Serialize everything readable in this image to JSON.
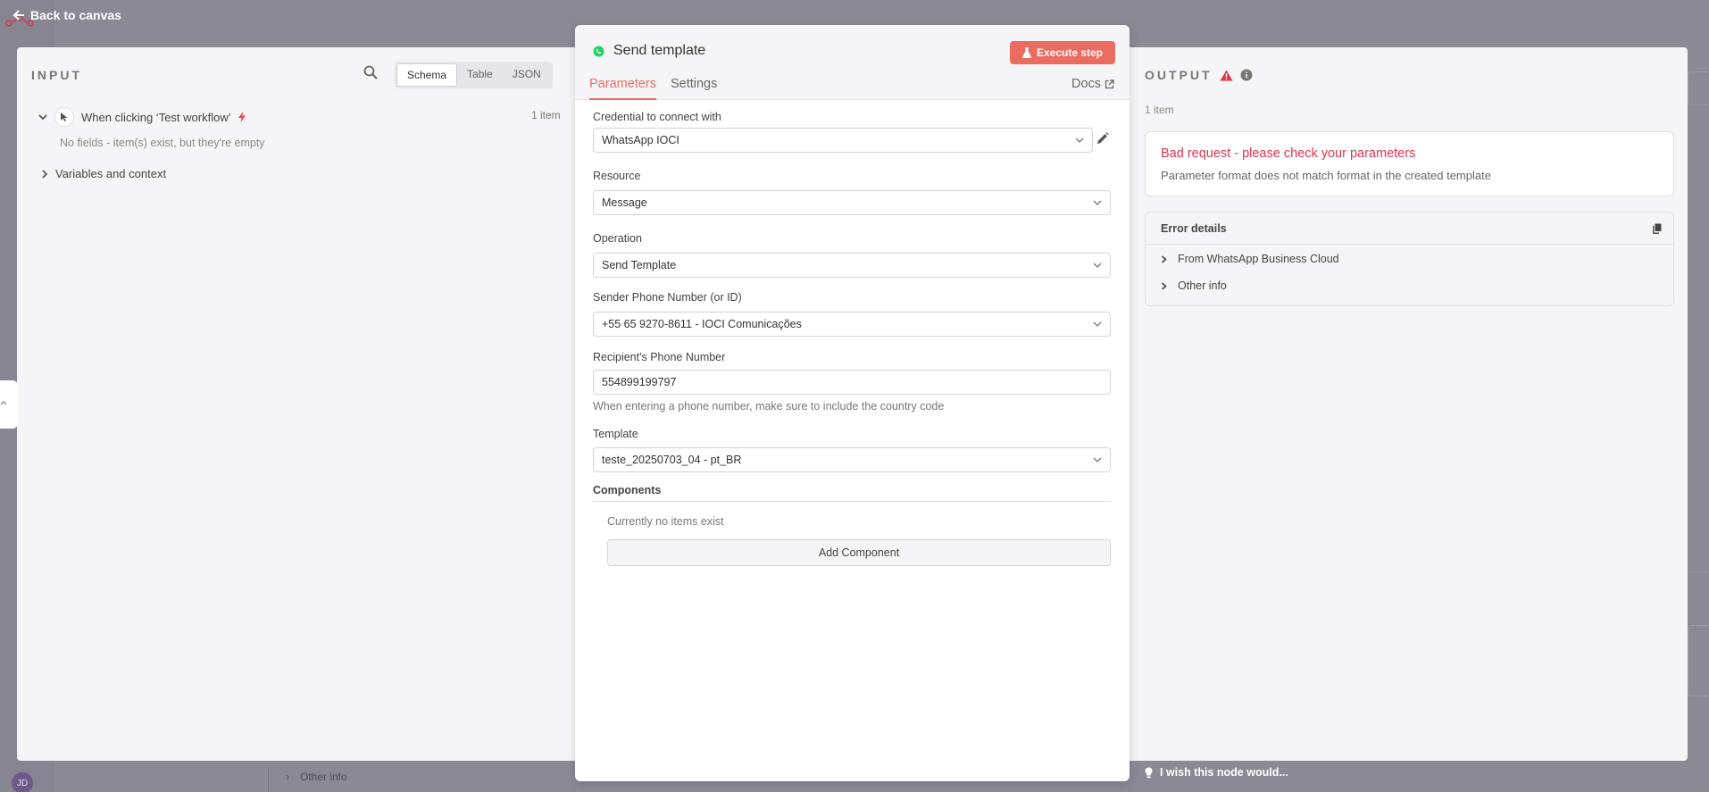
{
  "app": {
    "back_label": "Back to canvas",
    "bg_other_info": "Other info",
    "avatar_initials": "JD"
  },
  "input": {
    "title": "INPUT",
    "view_modes": [
      "Schema",
      "Table",
      "JSON"
    ],
    "active_view": "Schema",
    "trigger_name": "When clicking ‘Test workflow’",
    "item_count": "1 item",
    "empty_note": "No fields - item(s) exist, but they're empty",
    "variables_label": "Variables and context"
  },
  "node": {
    "title": "Send template",
    "execute_label": "Execute step",
    "tabs": [
      "Parameters",
      "Settings"
    ],
    "active_tab": "Parameters",
    "docs_label": "Docs",
    "fields": {
      "credential_label": "Credential to connect with",
      "credential_value": "WhatsApp IOCI",
      "resource_label": "Resource",
      "resource_value": "Message",
      "operation_label": "Operation",
      "operation_value": "Send Template",
      "sender_label": "Sender Phone Number (or ID)",
      "sender_value": "+55 65 9270-8611 - IOCI Comunicações",
      "recipient_label": "Recipient's Phone Number",
      "recipient_value": "554899199797",
      "recipient_hint": "When entering a phone number, make sure to include the country code",
      "template_label": "Template",
      "template_value": "teste_20250703_04 - pt_BR",
      "components_label": "Components",
      "components_empty": "Currently no items exist",
      "add_component_label": "Add Component"
    }
  },
  "output": {
    "title": "OUTPUT",
    "item_count": "1 item",
    "error_title": "Bad request - please check your parameters",
    "error_desc": "Parameter format does not match format in the created template",
    "details_title": "Error details",
    "details_rows": [
      "From WhatsApp Business Cloud",
      "Other info"
    ],
    "wish_label": "I wish this node would..."
  },
  "colors": {
    "accent": "#ea6b60",
    "error": "#e0344d",
    "whatsapp": "#25d366"
  }
}
